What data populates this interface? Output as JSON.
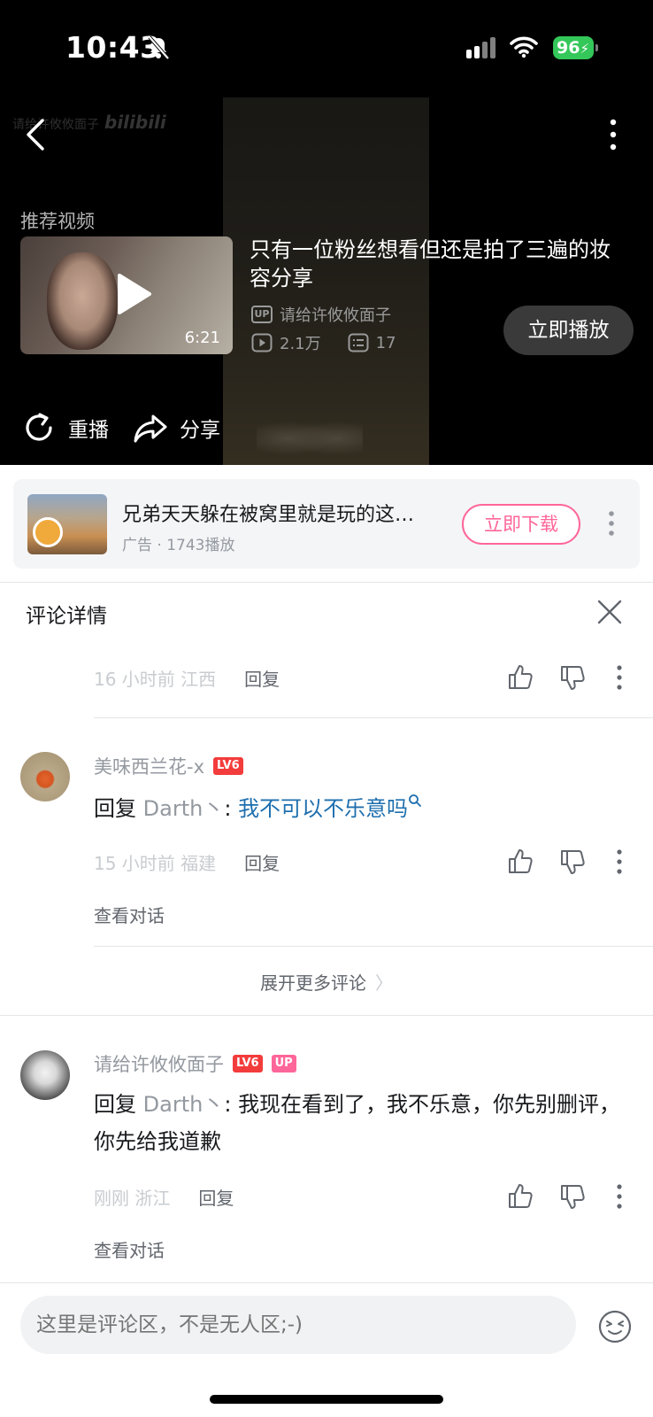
{
  "status_bar": {
    "time": "10:43",
    "battery": "96"
  },
  "video": {
    "watermark_text": "请给许攸攸面子",
    "watermark_logo": "bilibili",
    "recommend_label": "推荐视频",
    "rec_duration": "6:21",
    "rec_title": "只有一位粉丝想看但还是拍了三遍的妆容分享",
    "rec_up_badge": "UP",
    "rec_uploader": "请给许攸攸面子",
    "rec_views": "2.1万",
    "rec_danmaku": "17",
    "play_now_label": "立即播放",
    "replay_label": "重播",
    "share_label": "分享"
  },
  "ad": {
    "title": "兄弟天天躲在被窝里就是玩的这…",
    "meta": "广告 · 1743播放",
    "download_label": "立即下载"
  },
  "comment_detail": {
    "title": "评论详情",
    "reply_label": "回复",
    "view_conversation_label": "查看对话",
    "expand_label": "展开更多评论",
    "expand_chevron": "〉",
    "comments": [
      {
        "time_location": "16 小时前  江西"
      },
      {
        "username": "美味西兰花-x",
        "level": "LV6",
        "reply_prefix": "回复",
        "reply_to": "Darth丶",
        "colon": ":",
        "text": "我不可以不乐意吗",
        "time_location": "15 小时前  福建"
      },
      {
        "username": "请给许攸攸面子",
        "level": "LV6",
        "up_badge": "UP",
        "reply_prefix": "回复",
        "reply_to": "Darth丶",
        "colon": ":",
        "text": "我现在看到了，我不乐意，你先别删评，你先给我道歉",
        "time_location": "刚刚  浙江"
      }
    ]
  },
  "input_bar": {
    "placeholder": "这里是评论区，不是无人区;-)"
  },
  "colors": {
    "brand_pink": "#ff6699",
    "link_blue": "#1e6fae",
    "level_red": "#f33c3c",
    "battery_green": "#34c759"
  }
}
